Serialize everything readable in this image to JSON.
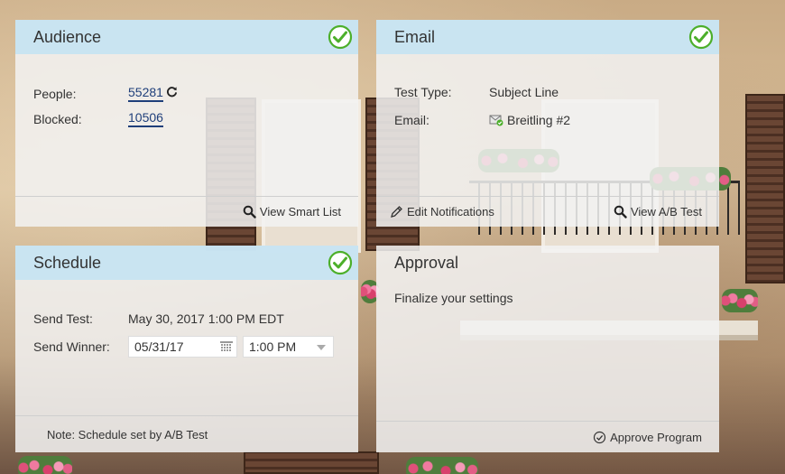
{
  "audience": {
    "title": "Audience",
    "people_label": "People:",
    "people_value": "55281",
    "blocked_label": "Blocked:",
    "blocked_value": "10506",
    "footer_action": "View Smart List"
  },
  "email": {
    "title": "Email",
    "test_type_label": "Test Type:",
    "test_type_value": "Subject Line",
    "email_label": "Email:",
    "email_value": "Breitling #2",
    "edit_notifications": "Edit Notifications",
    "view_ab_test": "View A/B Test"
  },
  "schedule": {
    "title": "Schedule",
    "send_test_label": "Send Test:",
    "send_test_value": "May 30, 2017 1:00 PM EDT",
    "send_winner_label": "Send Winner:",
    "winner_date": "05/31/17",
    "winner_time": "1:00 PM",
    "note": "Note: Schedule set by A/B Test"
  },
  "approval": {
    "title": "Approval",
    "message": "Finalize your settings",
    "approve_program": "Approve Program"
  },
  "colors": {
    "check_green": "#4caf2a",
    "header_blue": "#c6e3f2",
    "link_blue": "#1f3f7a"
  }
}
